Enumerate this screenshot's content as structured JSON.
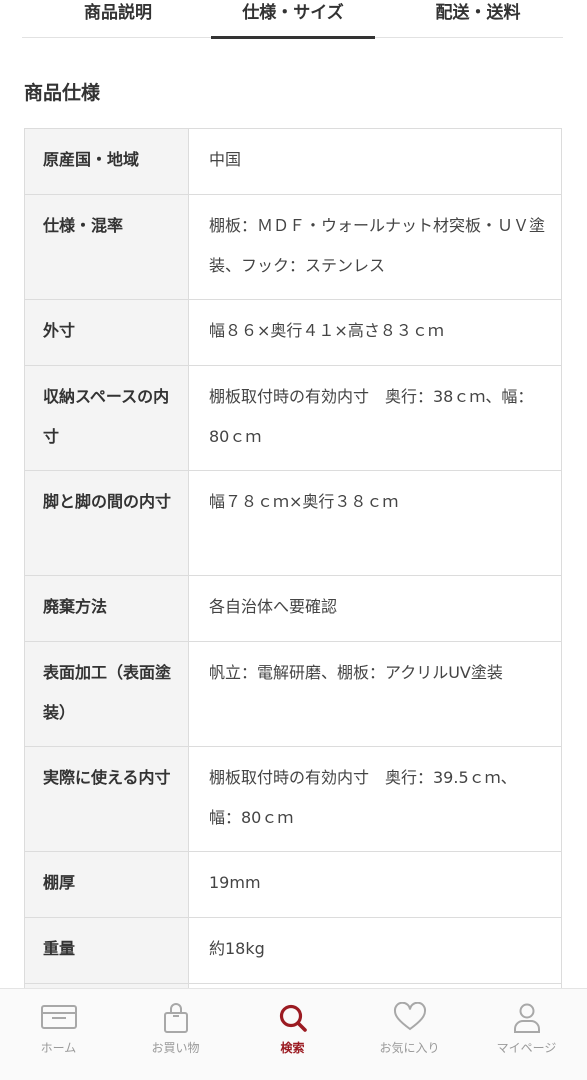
{
  "tabs": [
    {
      "label": "商品説明"
    },
    {
      "label": "仕様・サイズ"
    },
    {
      "label": "配送・送料"
    }
  ],
  "section": {
    "title": "商品仕様"
  },
  "specs": [
    {
      "label": "原産国・地域",
      "value": "中国"
    },
    {
      "label": "仕様・混率",
      "value": "棚板：ＭＤＦ・ウォールナット材突板・ＵＶ塗装、フック：ステンレス"
    },
    {
      "label": "外寸",
      "value": "幅８６×奥行４１×高さ８３ｃｍ"
    },
    {
      "label": "収納スペースの内寸",
      "value": "棚板取付時の有効内寸　奥行：38ｃｍ、幅：80ｃｍ"
    },
    {
      "label": "脚と脚の間の内寸",
      "value": "幅７８ｃｍ×奥行３８ｃｍ"
    },
    {
      "label": "廃棄方法",
      "value": "各自治体へ要確認"
    },
    {
      "label": "表面加工（表面塗装）",
      "value": "帆立：電解研磨、棚板：アクリルUV塗装"
    },
    {
      "label": "実際に使える内寸",
      "value": "棚板取付時の有効内寸　奥行：39.5ｃｍ、幅：80ｃｍ"
    },
    {
      "label": "棚厚",
      "value": "19mm"
    },
    {
      "label": "重量",
      "value": "約18kg"
    }
  ],
  "bottom_nav": [
    {
      "label": "ホーム",
      "icon": "home-card-icon"
    },
    {
      "label": "お買い物",
      "icon": "shopping-bag-icon"
    },
    {
      "label": "検索",
      "icon": "search-icon"
    },
    {
      "label": "お気に入り",
      "icon": "heart-icon"
    },
    {
      "label": "マイページ",
      "icon": "user-icon"
    }
  ],
  "colors": {
    "accent": "#9b1b22",
    "muted": "#9a9a9a",
    "label_bg": "#f4f4f4"
  }
}
